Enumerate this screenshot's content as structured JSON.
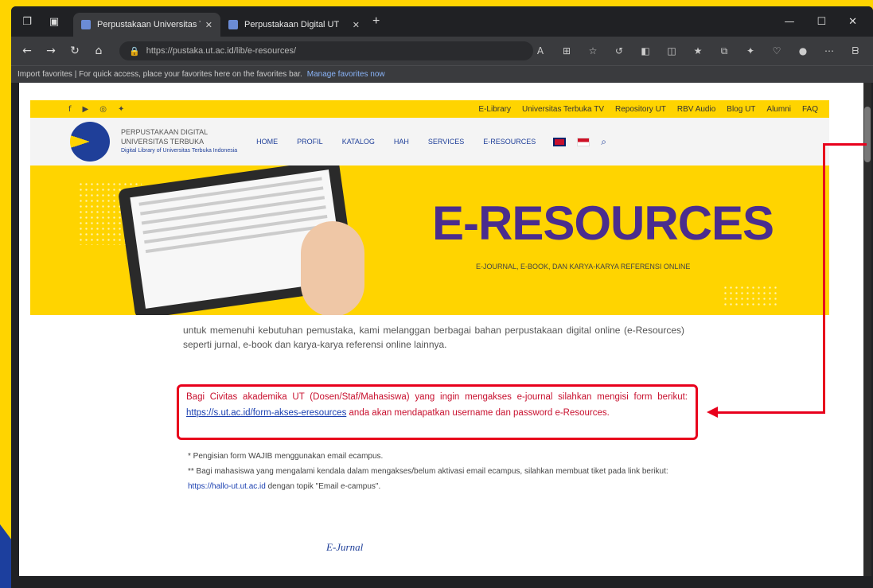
{
  "browser": {
    "tabs": [
      {
        "title": "Perpustakaan Universitas Terbuka",
        "active": true
      },
      {
        "title": "Perpustakaan Digital UT",
        "active": false
      }
    ],
    "new_tab": "+",
    "url": "https://pustaka.ut.ac.id/lib/e-resources/",
    "favorites_text": "Import favorites | For quick access, place your favorites here on the favorites bar.",
    "favorites_link": "Manage favorites now"
  },
  "site": {
    "toplinks": [
      "E-Library",
      "Universitas Terbuka TV",
      "Repository UT",
      "RBV Audio",
      "Blog UT",
      "Alumni",
      "FAQ"
    ],
    "logo_title": "PERPUSTAKAAN DIGITAL",
    "logo_title2": "UNIVERSITAS TERBUKA",
    "logo_sub": "Digital Library of Universitas Terbuka Indonesia",
    "menu": [
      "HOME",
      "PROFIL",
      "KATALOG",
      "HAH",
      "SERVICES",
      "E-RESOURCES"
    ],
    "banner_title": "E-RESOURCES",
    "banner_sub": "E-JOURNAL, E-BOOK, DAN KARYA-KARYA REFERENSI ONLINE"
  },
  "content": {
    "intro": "untuk memenuhi kebutuhan pemustaka, kami melanggan berbagai bahan perpustakaan digital online (e-Resources) seperti jurnal, e-book dan karya-karya referensi online lainnya.",
    "notice_pre": "Bagi Civitas akademika UT (Dosen/Staf/Mahasiswa) yang ingin mengakses e-journal silahkan mengisi form berikut: ",
    "notice_link": "https://s.ut.ac.id/form-akses-eresources",
    "notice_post": " anda akan mendapatkan username dan password e-Resources.",
    "note1": "* Pengisian form WAJIB menggunakan email ecampus.",
    "note2_pre": "** Bagi mahasiswa yang mengalami kendala dalam mengakses/belum aktivasi email ecampus, silahkan membuat tiket pada link berikut: ",
    "note2_link": "https://hallo-ut.ut.ac.id",
    "note2_post": " dengan topik \"Email e-campus\".",
    "ejurnal": "E-Jurnal"
  }
}
